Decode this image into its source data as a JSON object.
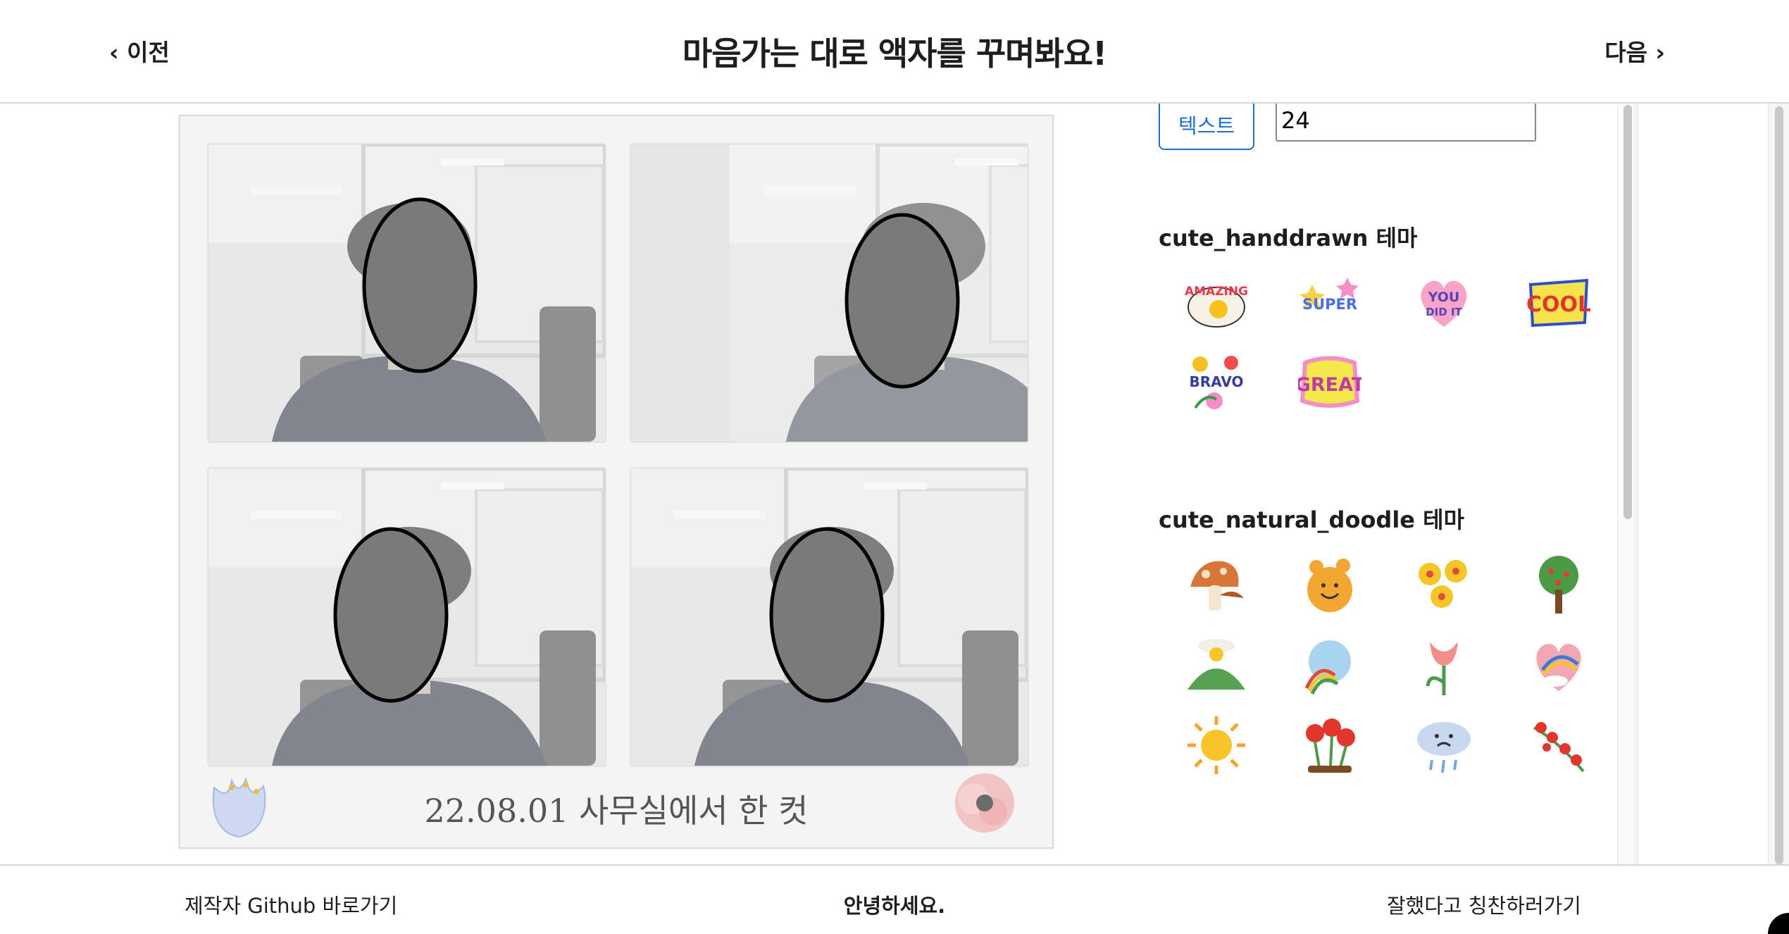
{
  "header": {
    "prev_label": "‹ 이전",
    "title": "마음가는 대로 액자를 꾸며봐요!",
    "next_label": "다음 ›"
  },
  "frame": {
    "caption": "22.08.01 사무실에서 한 컷",
    "photo_count": 4
  },
  "panel": {
    "text_button_label": "텍스트",
    "font_size_value": "24",
    "themes": [
      {
        "title": "cute_handdrawn 테마",
        "stickers": [
          "AMAZING",
          "SUPER",
          "YOU DID IT",
          "COOL",
          "BRAVO",
          "GREAT"
        ]
      },
      {
        "title": "cute_natural_doodle 테마",
        "stickers": [
          "mushroom",
          "orange-smile",
          "flowers",
          "tree",
          "mountain",
          "rainbow-cloud",
          "tulip",
          "rainbow-heart",
          "sun",
          "red-flowers",
          "sad-cloud",
          "berries"
        ]
      }
    ]
  },
  "footer": {
    "left_link": "제작자 Github 바로가기",
    "center_text": "안녕하세요.",
    "right_link": "잘했다고 칭찬하러가기"
  },
  "colors": {
    "accent": "#1c6fd6",
    "frame_bg": "#f4f4f4",
    "face_mask": "#7a7a7a"
  }
}
